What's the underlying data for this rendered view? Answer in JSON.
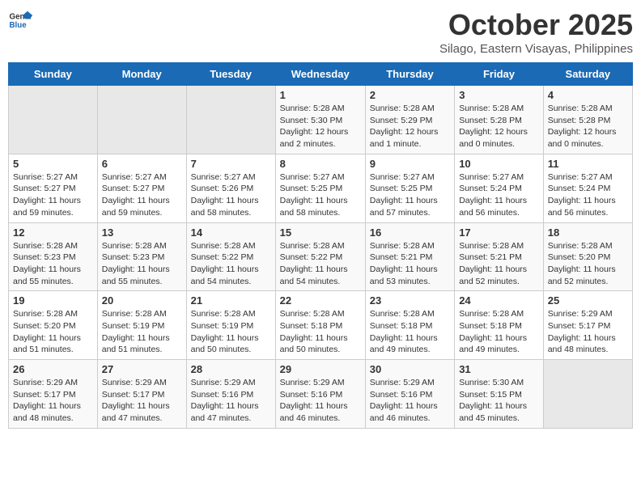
{
  "header": {
    "logo_line1": "General",
    "logo_line2": "Blue",
    "month": "October 2025",
    "location": "Silago, Eastern Visayas, Philippines"
  },
  "weekdays": [
    "Sunday",
    "Monday",
    "Tuesday",
    "Wednesday",
    "Thursday",
    "Friday",
    "Saturday"
  ],
  "weeks": [
    [
      {
        "num": "",
        "info": ""
      },
      {
        "num": "",
        "info": ""
      },
      {
        "num": "",
        "info": ""
      },
      {
        "num": "1",
        "info": "Sunrise: 5:28 AM\nSunset: 5:30 PM\nDaylight: 12 hours\nand 2 minutes."
      },
      {
        "num": "2",
        "info": "Sunrise: 5:28 AM\nSunset: 5:29 PM\nDaylight: 12 hours\nand 1 minute."
      },
      {
        "num": "3",
        "info": "Sunrise: 5:28 AM\nSunset: 5:28 PM\nDaylight: 12 hours\nand 0 minutes."
      },
      {
        "num": "4",
        "info": "Sunrise: 5:28 AM\nSunset: 5:28 PM\nDaylight: 12 hours\nand 0 minutes."
      }
    ],
    [
      {
        "num": "5",
        "info": "Sunrise: 5:27 AM\nSunset: 5:27 PM\nDaylight: 11 hours\nand 59 minutes."
      },
      {
        "num": "6",
        "info": "Sunrise: 5:27 AM\nSunset: 5:27 PM\nDaylight: 11 hours\nand 59 minutes."
      },
      {
        "num": "7",
        "info": "Sunrise: 5:27 AM\nSunset: 5:26 PM\nDaylight: 11 hours\nand 58 minutes."
      },
      {
        "num": "8",
        "info": "Sunrise: 5:27 AM\nSunset: 5:25 PM\nDaylight: 11 hours\nand 58 minutes."
      },
      {
        "num": "9",
        "info": "Sunrise: 5:27 AM\nSunset: 5:25 PM\nDaylight: 11 hours\nand 57 minutes."
      },
      {
        "num": "10",
        "info": "Sunrise: 5:27 AM\nSunset: 5:24 PM\nDaylight: 11 hours\nand 56 minutes."
      },
      {
        "num": "11",
        "info": "Sunrise: 5:27 AM\nSunset: 5:24 PM\nDaylight: 11 hours\nand 56 minutes."
      }
    ],
    [
      {
        "num": "12",
        "info": "Sunrise: 5:28 AM\nSunset: 5:23 PM\nDaylight: 11 hours\nand 55 minutes."
      },
      {
        "num": "13",
        "info": "Sunrise: 5:28 AM\nSunset: 5:23 PM\nDaylight: 11 hours\nand 55 minutes."
      },
      {
        "num": "14",
        "info": "Sunrise: 5:28 AM\nSunset: 5:22 PM\nDaylight: 11 hours\nand 54 minutes."
      },
      {
        "num": "15",
        "info": "Sunrise: 5:28 AM\nSunset: 5:22 PM\nDaylight: 11 hours\nand 54 minutes."
      },
      {
        "num": "16",
        "info": "Sunrise: 5:28 AM\nSunset: 5:21 PM\nDaylight: 11 hours\nand 53 minutes."
      },
      {
        "num": "17",
        "info": "Sunrise: 5:28 AM\nSunset: 5:21 PM\nDaylight: 11 hours\nand 52 minutes."
      },
      {
        "num": "18",
        "info": "Sunrise: 5:28 AM\nSunset: 5:20 PM\nDaylight: 11 hours\nand 52 minutes."
      }
    ],
    [
      {
        "num": "19",
        "info": "Sunrise: 5:28 AM\nSunset: 5:20 PM\nDaylight: 11 hours\nand 51 minutes."
      },
      {
        "num": "20",
        "info": "Sunrise: 5:28 AM\nSunset: 5:19 PM\nDaylight: 11 hours\nand 51 minutes."
      },
      {
        "num": "21",
        "info": "Sunrise: 5:28 AM\nSunset: 5:19 PM\nDaylight: 11 hours\nand 50 minutes."
      },
      {
        "num": "22",
        "info": "Sunrise: 5:28 AM\nSunset: 5:18 PM\nDaylight: 11 hours\nand 50 minutes."
      },
      {
        "num": "23",
        "info": "Sunrise: 5:28 AM\nSunset: 5:18 PM\nDaylight: 11 hours\nand 49 minutes."
      },
      {
        "num": "24",
        "info": "Sunrise: 5:28 AM\nSunset: 5:18 PM\nDaylight: 11 hours\nand 49 minutes."
      },
      {
        "num": "25",
        "info": "Sunrise: 5:29 AM\nSunset: 5:17 PM\nDaylight: 11 hours\nand 48 minutes."
      }
    ],
    [
      {
        "num": "26",
        "info": "Sunrise: 5:29 AM\nSunset: 5:17 PM\nDaylight: 11 hours\nand 48 minutes."
      },
      {
        "num": "27",
        "info": "Sunrise: 5:29 AM\nSunset: 5:17 PM\nDaylight: 11 hours\nand 47 minutes."
      },
      {
        "num": "28",
        "info": "Sunrise: 5:29 AM\nSunset: 5:16 PM\nDaylight: 11 hours\nand 47 minutes."
      },
      {
        "num": "29",
        "info": "Sunrise: 5:29 AM\nSunset: 5:16 PM\nDaylight: 11 hours\nand 46 minutes."
      },
      {
        "num": "30",
        "info": "Sunrise: 5:29 AM\nSunset: 5:16 PM\nDaylight: 11 hours\nand 46 minutes."
      },
      {
        "num": "31",
        "info": "Sunrise: 5:30 AM\nSunset: 5:15 PM\nDaylight: 11 hours\nand 45 minutes."
      },
      {
        "num": "",
        "info": ""
      }
    ]
  ]
}
